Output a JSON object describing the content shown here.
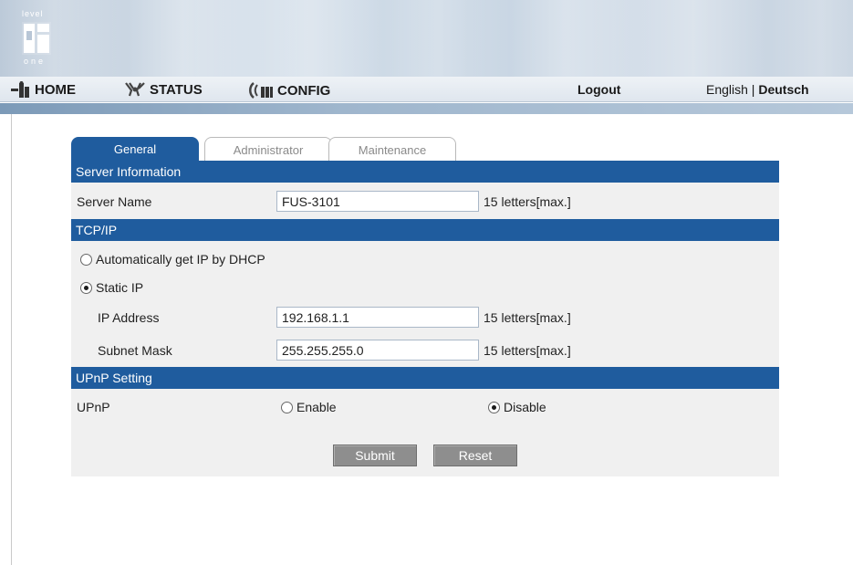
{
  "brand": {
    "logo_top": "level",
    "logo_bottom": "one"
  },
  "nav": {
    "home": "HOME",
    "status": "STATUS",
    "config": "CONFIG",
    "logout": "Logout",
    "lang_en": "English",
    "lang_sep": " | ",
    "lang_de": "Deutsch"
  },
  "tabs": {
    "general": "General",
    "administrator": "Administrator",
    "maintenance": "Maintenance"
  },
  "server_info": {
    "section": "Server Information",
    "name_label": "Server Name",
    "name_value": "FUS-3101",
    "name_hint": "15 letters[max.]"
  },
  "tcpip": {
    "section": "TCP/IP",
    "dhcp_label": "Automatically get IP by DHCP",
    "dhcp_selected": false,
    "static_label": "Static IP",
    "static_selected": true,
    "ip_label": "IP Address",
    "ip_value": "192.168.1.1",
    "ip_hint": "15 letters[max.]",
    "mask_label": "Subnet Mask",
    "mask_value": "255.255.255.0",
    "mask_hint": "15 letters[max.]"
  },
  "upnp": {
    "section": "UPnP Setting",
    "label": "UPnP",
    "enable_label": "Enable",
    "enable_selected": false,
    "disable_label": "Disable",
    "disable_selected": true
  },
  "actions": {
    "submit": "Submit",
    "reset": "Reset"
  },
  "colors": {
    "accent": "#1f5c9e",
    "panel_bg": "#f0f0f0",
    "button_bg": "#8e8e8e"
  }
}
